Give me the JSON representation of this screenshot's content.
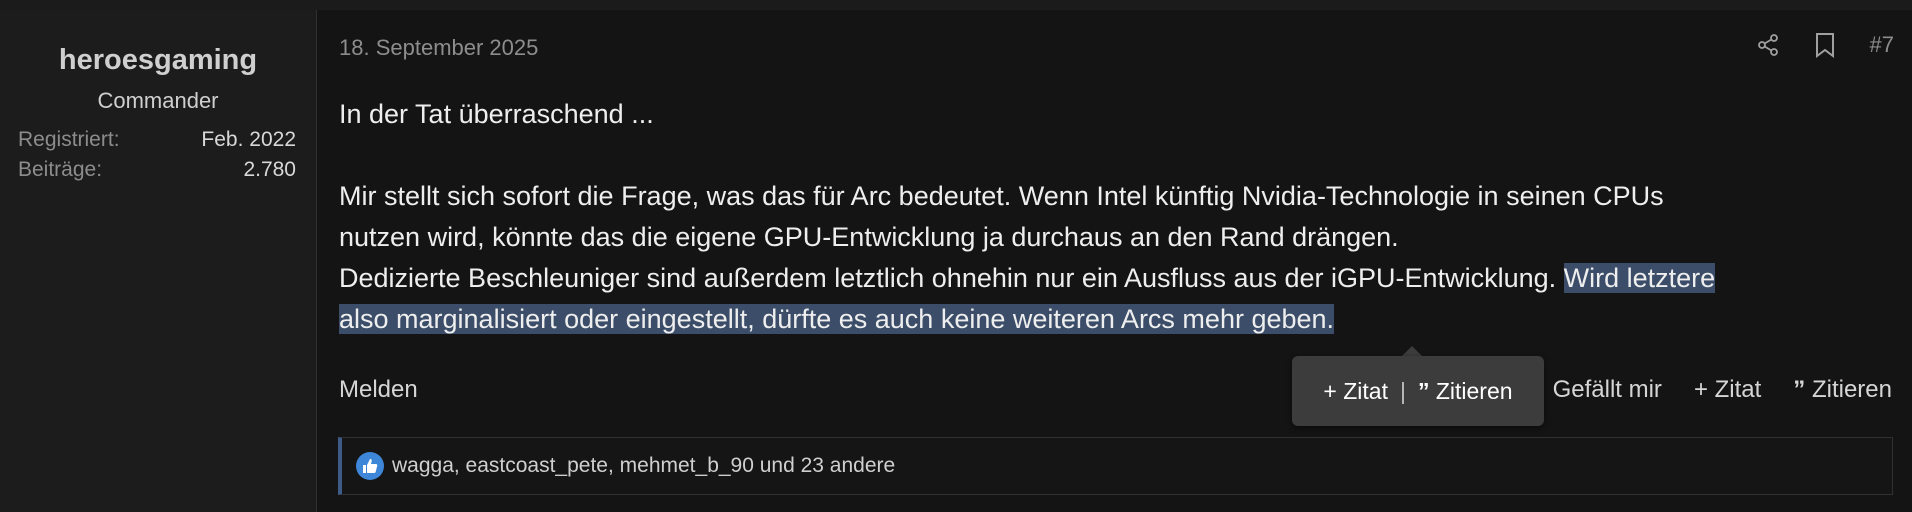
{
  "user": {
    "name": "heroesgaming",
    "title": "Commander",
    "stats": [
      {
        "label": "Registriert:",
        "value": "Feb. 2022"
      },
      {
        "label": "Beiträge:",
        "value": "2.780"
      }
    ]
  },
  "post": {
    "date": "18. September 2025",
    "number": "#7",
    "paragraph1": "In der Tat überraschend ...",
    "line1": "Mir stellt sich sofort die Frage, was das für Arc bedeutet. Wenn Intel künftig Nvidia-Technologie in seinen CPUs",
    "line2": "nutzen wird, könnte das die eigene GPU-Entwicklung ja durchaus an den Rand drängen.",
    "line3a": "Dedizierte Beschleuniger sind außerdem letztlich ohnehin nur ein Ausfluss aus der iGPU-Entwicklung. ",
    "line3b": "Wird letztere",
    "line4": "also marginalisiert oder eingestellt, dürfte es auch keine weiteren Arcs mehr geben."
  },
  "actions": {
    "report": "Melden",
    "like": "Gefällt mir",
    "quote_add": "+ Zitat",
    "cite": "Zitieren"
  },
  "popup": {
    "quote_add": "+ Zitat",
    "separator": "|",
    "cite": "Zitieren"
  },
  "likes": {
    "text": "wagga, eastcoast_pete, mehmet_b_90 und 23 andere"
  },
  "icons": {
    "share": "share-icon",
    "bookmark": "bookmark-icon",
    "quote": "quote-icon",
    "like": "thumbs-up-icon"
  },
  "colors": {
    "highlight": "#3b4d68",
    "like_accent": "#3d86d8"
  }
}
